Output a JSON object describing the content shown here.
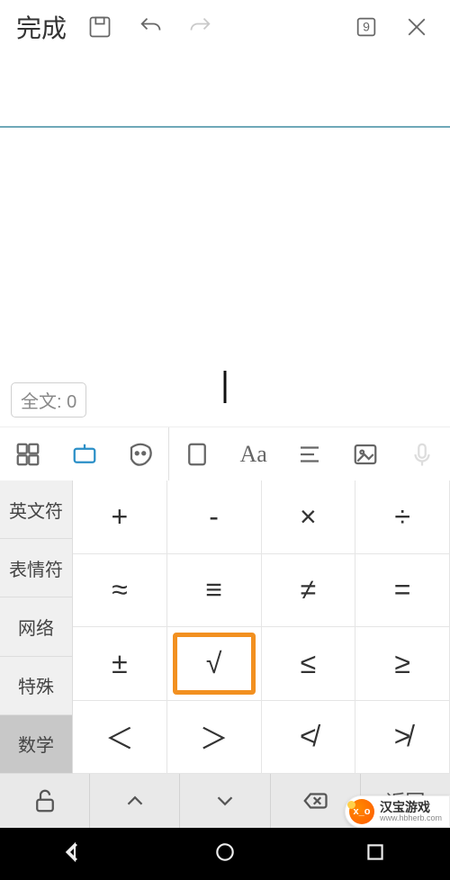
{
  "toolbar": {
    "done_label": "完成",
    "keypad_label": "9"
  },
  "editor": {
    "wordcount_label": "全文: 0"
  },
  "formatbar": {
    "aa_label": "Aa"
  },
  "symcats": [
    {
      "label": "英文符"
    },
    {
      "label": "表情符"
    },
    {
      "label": "网络"
    },
    {
      "label": "特殊"
    },
    {
      "label": "数学"
    }
  ],
  "symgrid": {
    "r0": [
      "+",
      "-",
      "×",
      "÷"
    ],
    "r1": [
      "≈",
      "≡",
      "≠",
      "="
    ],
    "r2": [
      "±",
      "√",
      "≤",
      "≥"
    ],
    "r3": [
      "＜",
      "＞",
      "≮",
      "≯"
    ]
  },
  "actionrow": {
    "back_label": "返回"
  },
  "watermark": {
    "logo_text": "x_o",
    "title": "汉宝游戏",
    "sub": "www.hbherb.com"
  }
}
